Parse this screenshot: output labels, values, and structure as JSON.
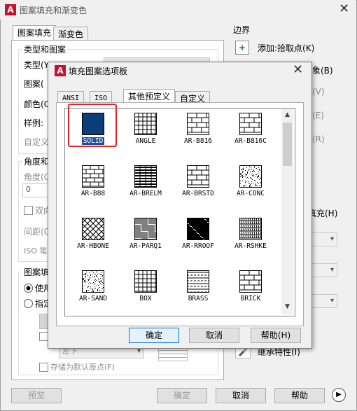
{
  "main_window": {
    "title": "图案填充和渐变色",
    "tabs": [
      "图案填充",
      "渐变色"
    ],
    "left": {
      "group_type": "类型和图案",
      "type_label": "类型(Y",
      "pattern_label": "图案(",
      "color_label": "颜色(C",
      "swatch_label": "样例:",
      "custom_label": "自定义",
      "group_angle": "角度和",
      "angle_label": "角度(G",
      "angle_value": "0",
      "double_label": "双向",
      "spacing_label": "间距(C",
      "iso_label": "ISO 笔",
      "group_origin": "图案填",
      "use_label": "使用",
      "specify_label": "指定",
      "position_value": "左下",
      "store_default": "存储为默认原点(F)"
    },
    "right": {
      "border_title": "边界",
      "add_pick": "添加:拾取点(K)",
      "add_select_partial": "象(B)",
      "partial_e": "(E)",
      "partial_r": "(R)",
      "partial_v": "(V)",
      "fill_partial": "真充(H)",
      "inherit": "继承特性(I)"
    },
    "bottom": {
      "preview": "预览",
      "ok": "确定",
      "cancel": "取消",
      "help": "帮助"
    }
  },
  "palette": {
    "title": "填充图案选项板",
    "tabs": [
      "ANSI",
      "ISO",
      "其他预定义",
      "自定义"
    ],
    "active_tab": "其他预定义",
    "patterns": [
      "SOLID",
      "ANGLE",
      "AR-B816",
      "AR-B816C",
      "AR-B88",
      "AR-BRELM",
      "AR-BRSTD",
      "AR-CONC",
      "AR-HBONE",
      "AR-PARQ1",
      "AR-RROOF",
      "AR-RSHKE",
      "AR-SAND",
      "BOX",
      "BRASS",
      "BRICK"
    ],
    "selected": "SOLID",
    "buttons": {
      "ok": "确定",
      "cancel": "取消",
      "help": "帮助(H)"
    }
  },
  "colors": {
    "selection": "#1b4f9c",
    "highlight_box": "#e0262a",
    "solid_fill": "#0a3e78"
  }
}
